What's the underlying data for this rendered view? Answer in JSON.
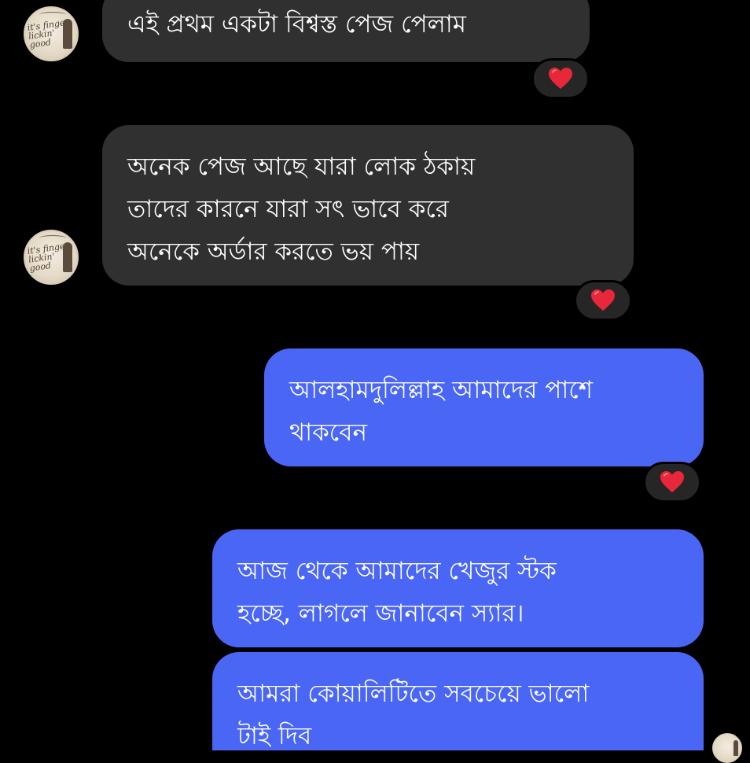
{
  "avatar_logo_text": "it's finger lickin' good",
  "messages": [
    {
      "lines": [
        "এই প্রথম একটা বিশ্বস্ত  পেজ পেলাম"
      ],
      "reaction": "heart-icon"
    },
    {
      "lines": [
        "অনেক পেজ আছে যারা লোক ঠকায়",
        "তাদের কারনে যারা সৎ ভাবে করে",
        "অনেকে অর্ডার করতে ভয় পায়"
      ],
      "reaction": "heart-icon"
    },
    {
      "lines": [
        "আলহামদুলিল্লাহ আমাদের পাশে",
        "থাকবেন"
      ],
      "reaction": "heart-icon"
    },
    {
      "lines": [
        "আজ থেকে আমাদের খেজুর স্টক",
        "হচ্ছে, লাগলে জানাবেন স্যার।"
      ]
    },
    {
      "lines": [
        "আমরা কোয়ালিটিতে সবচেয়ে ভালো",
        "টাই দিব"
      ]
    }
  ],
  "colors": {
    "background": "#000000",
    "incoming_bubble": "#303030",
    "outgoing_bubble": "#4a66f5",
    "reaction_pill": "#262626",
    "heart": "#e8283a",
    "text": "#ffffff"
  }
}
